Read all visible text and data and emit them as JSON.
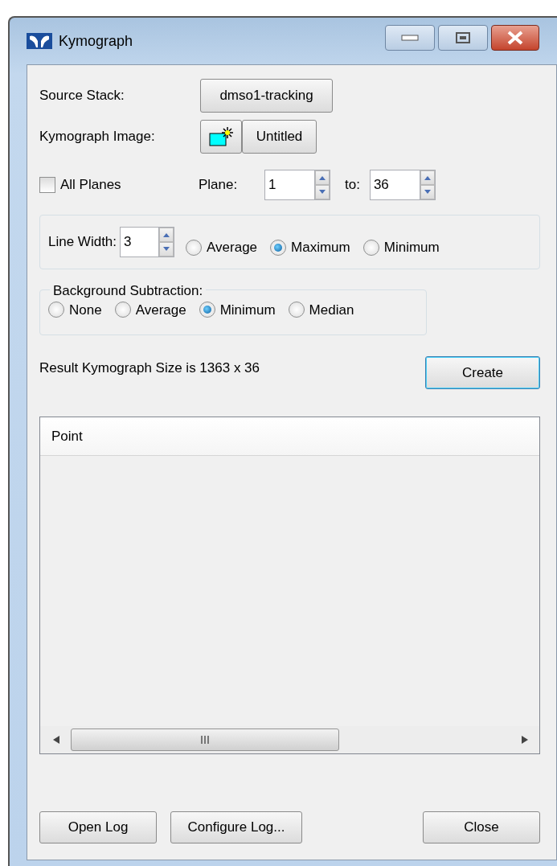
{
  "window": {
    "title": "Kymograph"
  },
  "source_stack": {
    "label": "Source Stack:",
    "button": "dmso1-tracking"
  },
  "kymograph_image": {
    "label": "Kymograph Image:",
    "button": "Untitled"
  },
  "all_planes": {
    "label": "All Planes",
    "checked": false
  },
  "plane": {
    "label": "Plane:",
    "value": "1"
  },
  "to": {
    "label": "to:",
    "value": "36"
  },
  "line_width": {
    "label": "Line Width:",
    "value": "3",
    "options": [
      {
        "label": "Average",
        "selected": false
      },
      {
        "label": "Maximum",
        "selected": true
      },
      {
        "label": "Minimum",
        "selected": false
      }
    ]
  },
  "background_subtraction": {
    "title": "Background Subtraction:",
    "options": [
      {
        "label": "None",
        "selected": false
      },
      {
        "label": "Average",
        "selected": false
      },
      {
        "label": "Minimum",
        "selected": true
      },
      {
        "label": "Median",
        "selected": false
      }
    ]
  },
  "result": "Result Kymograph Size is 1363 x 36",
  "create_button": "Create",
  "table": {
    "columns": [
      "Point"
    ]
  },
  "buttons": [
    "Open Log",
    "Configure Log...",
    "Close"
  ]
}
